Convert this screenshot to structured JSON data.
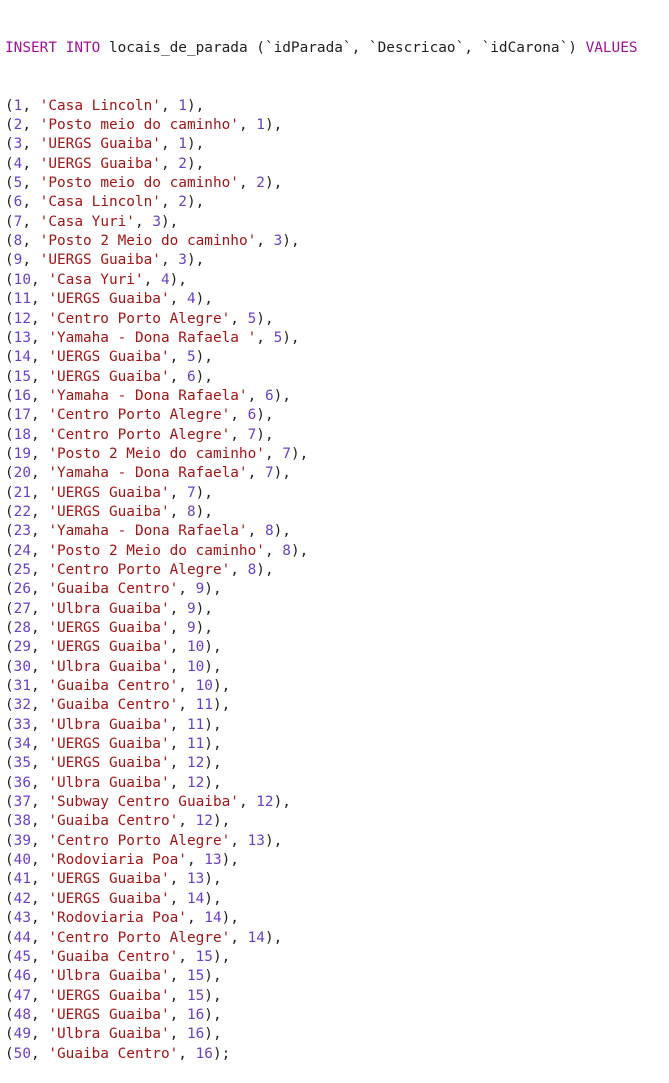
{
  "editor": {
    "statement": {
      "keyword_insert": "INSERT",
      "keyword_into": "INTO",
      "table": "locais_de_parada",
      "columns": [
        "idParada",
        "Descricao",
        "idCarona"
      ],
      "keyword_values": "VALUES"
    },
    "rows": [
      {
        "id": "1",
        "desc": "'Casa Lincoln'",
        "carona": "1"
      },
      {
        "id": "2",
        "desc": "'Posto meio do caminho'",
        "carona": "1"
      },
      {
        "id": "3",
        "desc": "'UERGS Guaiba'",
        "carona": "1"
      },
      {
        "id": "4",
        "desc": "'UERGS Guaiba'",
        "carona": "2"
      },
      {
        "id": "5",
        "desc": "'Posto meio do caminho'",
        "carona": "2"
      },
      {
        "id": "6",
        "desc": "'Casa Lincoln'",
        "carona": "2"
      },
      {
        "id": "7",
        "desc": "'Casa Yuri'",
        "carona": "3"
      },
      {
        "id": "8",
        "desc": "'Posto 2 Meio do caminho'",
        "carona": "3"
      },
      {
        "id": "9",
        "desc": "'UERGS Guaiba'",
        "carona": "3"
      },
      {
        "id": "10",
        "desc": "'Casa Yuri'",
        "carona": "4"
      },
      {
        "id": "11",
        "desc": "'UERGS Guaiba'",
        "carona": "4"
      },
      {
        "id": "12",
        "desc": "'Centro Porto Alegre'",
        "carona": "5"
      },
      {
        "id": "13",
        "desc": "'Yamaha - Dona Rafaela '",
        "carona": "5"
      },
      {
        "id": "14",
        "desc": "'UERGS Guaiba'",
        "carona": "5"
      },
      {
        "id": "15",
        "desc": "'UERGS Guaiba'",
        "carona": "6"
      },
      {
        "id": "16",
        "desc": "'Yamaha - Dona Rafaela'",
        "carona": "6"
      },
      {
        "id": "17",
        "desc": "'Centro Porto Alegre'",
        "carona": "6"
      },
      {
        "id": "18",
        "desc": "'Centro Porto Alegre'",
        "carona": "7"
      },
      {
        "id": "19",
        "desc": "'Posto 2 Meio do caminho'",
        "carona": "7"
      },
      {
        "id": "20",
        "desc": "'Yamaha - Dona Rafaela'",
        "carona": "7"
      },
      {
        "id": "21",
        "desc": "'UERGS Guaiba'",
        "carona": "7"
      },
      {
        "id": "22",
        "desc": "'UERGS Guaiba'",
        "carona": "8"
      },
      {
        "id": "23",
        "desc": "'Yamaha - Dona Rafaela'",
        "carona": "8"
      },
      {
        "id": "24",
        "desc": "'Posto 2 Meio do caminho'",
        "carona": "8"
      },
      {
        "id": "25",
        "desc": "'Centro Porto Alegre'",
        "carona": "8"
      },
      {
        "id": "26",
        "desc": "'Guaiba Centro'",
        "carona": "9"
      },
      {
        "id": "27",
        "desc": "'Ulbra Guaiba'",
        "carona": "9"
      },
      {
        "id": "28",
        "desc": "'UERGS Guaiba'",
        "carona": "9"
      },
      {
        "id": "29",
        "desc": "'UERGS Guaiba'",
        "carona": "10"
      },
      {
        "id": "30",
        "desc": "'Ulbra Guaiba'",
        "carona": "10"
      },
      {
        "id": "31",
        "desc": "'Guaiba Centro'",
        "carona": "10"
      },
      {
        "id": "32",
        "desc": "'Guaiba Centro'",
        "carona": "11"
      },
      {
        "id": "33",
        "desc": "'Ulbra Guaiba'",
        "carona": "11"
      },
      {
        "id": "34",
        "desc": "'UERGS Guaiba'",
        "carona": "11"
      },
      {
        "id": "35",
        "desc": "'UERGS Guaiba'",
        "carona": "12"
      },
      {
        "id": "36",
        "desc": "'Ulbra Guaiba'",
        "carona": "12"
      },
      {
        "id": "37",
        "desc": "'Subway Centro Guaiba'",
        "carona": "12"
      },
      {
        "id": "38",
        "desc": "'Guaiba Centro'",
        "carona": "12"
      },
      {
        "id": "39",
        "desc": "'Centro Porto Alegre'",
        "carona": "13"
      },
      {
        "id": "40",
        "desc": "'Rodoviaria Poa'",
        "carona": "13"
      },
      {
        "id": "41",
        "desc": "'UERGS Guaiba'",
        "carona": "13"
      },
      {
        "id": "42",
        "desc": "'UERGS Guaiba'",
        "carona": "14"
      },
      {
        "id": "43",
        "desc": "'Rodoviaria Poa'",
        "carona": "14"
      },
      {
        "id": "44",
        "desc": "'Centro Porto Alegre'",
        "carona": "14"
      },
      {
        "id": "45",
        "desc": "'Guaiba Centro'",
        "carona": "15"
      },
      {
        "id": "46",
        "desc": "'Ulbra Guaiba'",
        "carona": "15"
      },
      {
        "id": "47",
        "desc": "'UERGS Guaiba'",
        "carona": "15"
      },
      {
        "id": "48",
        "desc": "'UERGS Guaiba'",
        "carona": "16"
      },
      {
        "id": "49",
        "desc": "'Ulbra Guaiba'",
        "carona": "16"
      },
      {
        "id": "50",
        "desc": "'Guaiba Centro'",
        "carona": "16"
      }
    ]
  },
  "colors": {
    "keyword": "#a0109a",
    "string": "#a31515",
    "number": "#6a3fc8",
    "text": "#1f1f1f",
    "background": "#ffffff"
  }
}
